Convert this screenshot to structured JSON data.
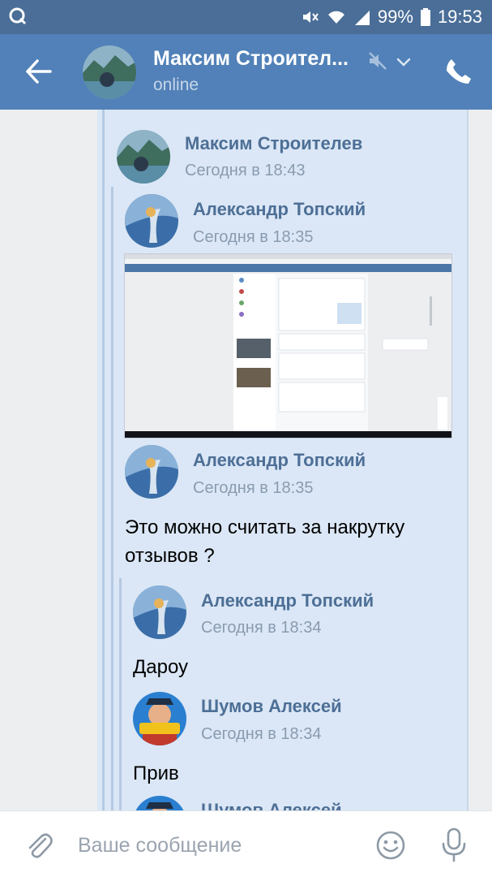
{
  "status": {
    "battery": "99%",
    "time": "19:53"
  },
  "header": {
    "title": "Максим Строител...",
    "subtitle": "online"
  },
  "messages": [
    {
      "name": "Максим Строителев",
      "time": "Сегодня в 18:43"
    },
    {
      "name": "Александр Топский",
      "time": "Сегодня в 18:35",
      "has_image": true
    },
    {
      "name": "Александр Топский",
      "time": "Сегодня в 18:35",
      "text": "Это можно считать за накрутку отзывов ?"
    },
    {
      "name": "Александр Топский",
      "time": "Сегодня в 18:34",
      "text": "Дароу"
    },
    {
      "name": "Шумов Алексей",
      "time": "Сегодня в 18:34",
      "text": "Прив"
    },
    {
      "name": "Шумов Алексей"
    }
  ],
  "input": {
    "placeholder": "Ваше сообщение"
  },
  "colors": {
    "app_bar": "#5181b8",
    "status_bar": "#4a6e97",
    "bubble": "#dbe7f6",
    "name": "#4d6f96"
  },
  "icons": [
    "q-app-icon",
    "mute-icon",
    "wifi-icon",
    "signal-icon",
    "battery-icon",
    "back-arrow-icon",
    "bell-off-icon",
    "chevron-down-icon",
    "phone-icon",
    "attach-icon",
    "smile-icon",
    "mic-icon"
  ]
}
